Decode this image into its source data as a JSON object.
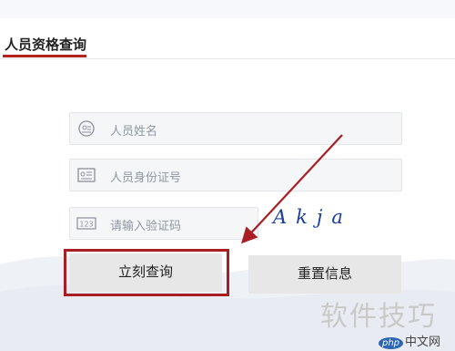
{
  "tab": {
    "title": "人员资格查询"
  },
  "form": {
    "name_placeholder": "人员姓名",
    "id_placeholder": "人员身份证号",
    "captcha_placeholder": "请输入验证码",
    "captcha_text": "Akja",
    "icons": [
      "user-badge-icon",
      "id-card-icon",
      "number-code-icon"
    ]
  },
  "buttons": {
    "query_label": "立刻查询",
    "reset_label": "重置信息"
  },
  "annotation": {
    "highlight_color": "#a81e22"
  },
  "watermark": {
    "text": "软件技巧",
    "site_badge": "php",
    "site_text": "中文网"
  },
  "colors": {
    "accent": "#b5221d",
    "field_bg": "#f5f6f8",
    "button_bg": "#e7e7e7"
  }
}
